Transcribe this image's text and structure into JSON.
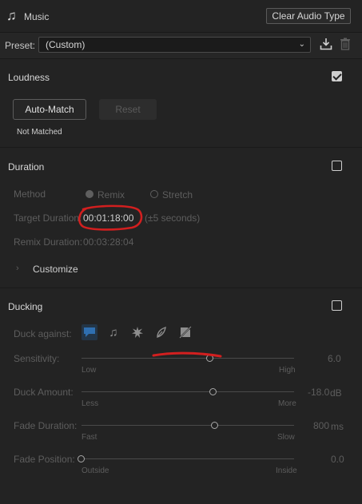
{
  "header": {
    "icon": "music-note-icon",
    "title": "Music",
    "clear_button": "Clear Audio Type"
  },
  "preset": {
    "label": "Preset:",
    "value": "(Custom)"
  },
  "loudness": {
    "title": "Loudness",
    "checked": true,
    "auto_match_label": "Auto-Match",
    "reset_label": "Reset",
    "status": "Not Matched"
  },
  "duration": {
    "title": "Duration",
    "checked": false,
    "method_label": "Method",
    "method_options": [
      "Remix",
      "Stretch"
    ],
    "method_selected": "Remix",
    "target_label": "Target Duration:",
    "target_value": "00:01:18:00",
    "target_tolerance": "(±5 seconds)",
    "remix_label": "Remix Duration:",
    "remix_value": "00:03:28:04",
    "customize_label": "Customize"
  },
  "ducking": {
    "title": "Ducking",
    "checked": false,
    "duck_against_label": "Duck against:",
    "duck_icons": [
      "dialogue-icon",
      "music-icon",
      "sfx-icon",
      "ambience-icon",
      "unassigned-icon"
    ],
    "sliders": [
      {
        "label": "Sensitivity:",
        "min_label": "Low",
        "max_label": "High",
        "value": "6.0",
        "unit": "",
        "fraction": 0.6
      },
      {
        "label": "Duck Amount:",
        "min_label": "Less",
        "max_label": "More",
        "value": "-18.0",
        "unit": "dB",
        "fraction": 0.6
      },
      {
        "label": "Fade Duration:",
        "min_label": "Fast",
        "max_label": "Slow",
        "value": "800",
        "unit": "ms",
        "fraction": 0.62
      },
      {
        "label": "Fade Position:",
        "min_label": "Outside",
        "max_label": "Inside",
        "value": "0.0",
        "unit": "",
        "fraction": 0.0
      }
    ]
  },
  "colors": {
    "background": "#232323",
    "annotation_red": "#d21f1f",
    "active_duck": "#2f6fb0"
  }
}
